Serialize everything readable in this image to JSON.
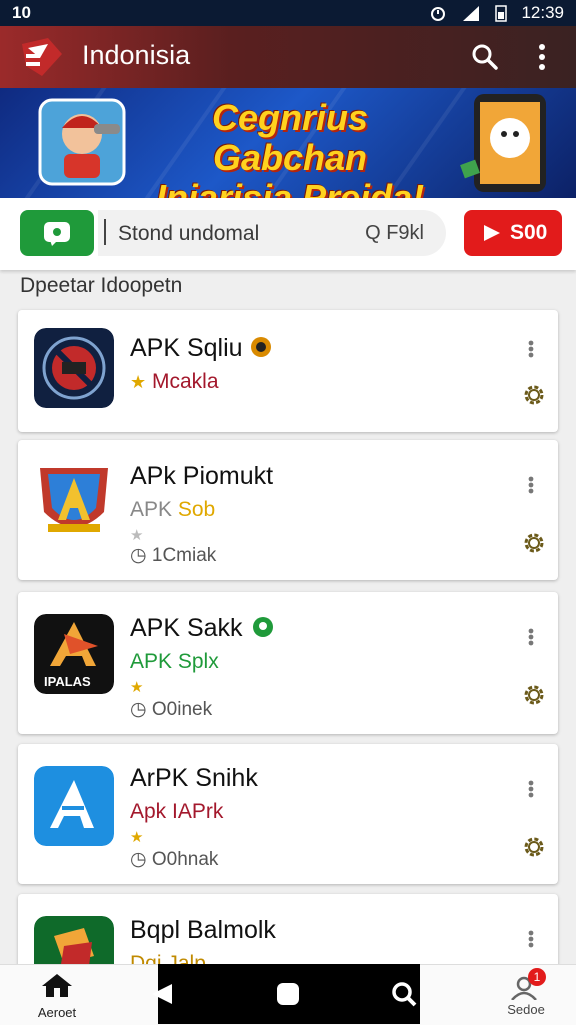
{
  "status_bar": {
    "left_text": "10",
    "time": "12:39"
  },
  "app_bar": {
    "title": "Indonisia",
    "search_icon": "search-icon",
    "more_icon": "more-vert-icon"
  },
  "banner": {
    "line1": "Cegnrius Gabchan",
    "line2": "Iniarisia Preida!"
  },
  "search": {
    "placeholder": "Stond undomal",
    "hint": "Q F9kl",
    "red_button_label": "S00",
    "green_button_icon": "chat-icon"
  },
  "section_title": "Dpeetar Idoopetn",
  "apps": [
    {
      "name": "APK Sqliu",
      "sub": "Mcakla",
      "sub_color": "#a3182c",
      "meta": "",
      "badge_color": "#d98a00"
    },
    {
      "name": "APk Piomukt",
      "sub_a": "APK",
      "sub_b": "Sob",
      "meta": "1Cmiak"
    },
    {
      "name": "APK Sakk",
      "sub": "APK Splx",
      "sub_color": "#1f9a3a",
      "meta": "O0inek",
      "badge_color": "#1f9a3a"
    },
    {
      "name": "ArPK Snihk",
      "sub": "Apk IAPrk",
      "sub_color": "#a3182c",
      "meta": "O0hnak"
    },
    {
      "name": "Bqpl Balmolk",
      "sub": "Dqi Jalp",
      "sub_color": "#c08a00",
      "meta": ""
    }
  ],
  "app3_icon_text": "IPALAS",
  "bottom_nav": {
    "home_label": "Aeroet",
    "user_label": "Sedoe",
    "badge_count": "1"
  },
  "colors": {
    "accent_red": "#e21b1b",
    "accent_green": "#1f9a3a",
    "banner_blue": "#1d58c8"
  }
}
